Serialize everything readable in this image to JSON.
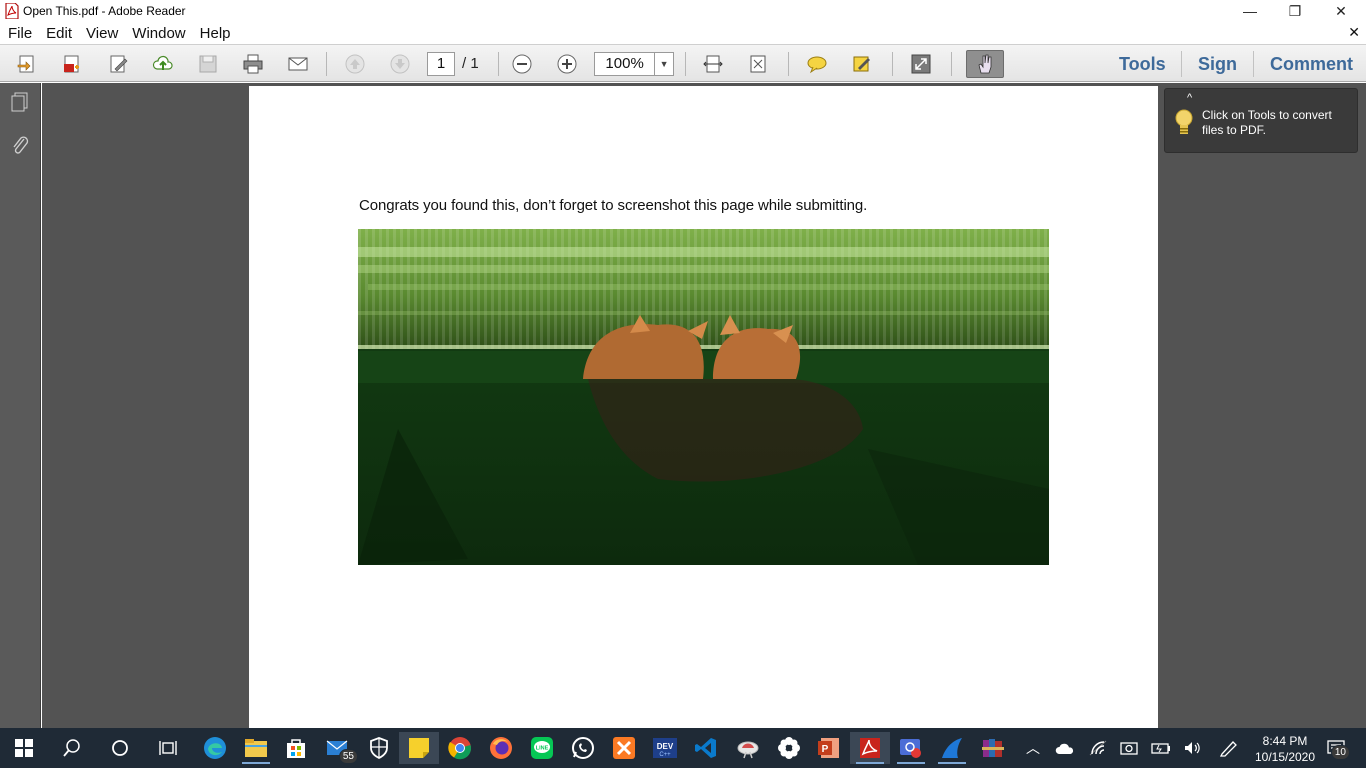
{
  "window": {
    "title": "Open This.pdf - Adobe Reader",
    "minimize_glyph": "—",
    "restore_glyph": "❐",
    "close_glyph": "✕"
  },
  "menu": {
    "items": [
      "File",
      "Edit",
      "View",
      "Window",
      "Help"
    ],
    "close_glyph": "✕"
  },
  "toolbar": {
    "page_current": "1",
    "page_of": "/ 1",
    "zoom": "100%",
    "tools_label": "Tools",
    "sign_label": "Sign",
    "comment_label": "Comment",
    "accent_color": "#3e6a9a"
  },
  "tooltip": {
    "caret": "^",
    "text": "Click on Tools to convert files to PDF."
  },
  "document": {
    "text": "Congrats you found this, don’t forget to screenshot this page while submitting.",
    "image_description_icon": "cats-image"
  },
  "taskbar": {
    "time": "8:44 PM",
    "date": "10/15/2020",
    "mail_badge": "55",
    "notification_badge": "10"
  }
}
